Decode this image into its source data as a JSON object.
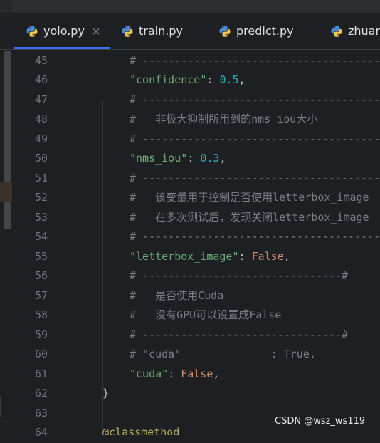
{
  "tabs": [
    {
      "label": "yolo.py",
      "close": "×",
      "active": true
    },
    {
      "label": "train.py",
      "active": false
    },
    {
      "label": "predict.py",
      "active": false
    },
    {
      "label": "zhuan",
      "active": false
    }
  ],
  "lines": [
    {
      "no": "45",
      "segments": [
        {
          "cls": "c-comment",
          "text": "# ---------------------------------------"
        }
      ]
    },
    {
      "no": "46",
      "segments": [
        {
          "cls": "c-str",
          "text": "\"confidence\""
        },
        {
          "cls": "c-punc",
          "text": ": "
        },
        {
          "cls": "c-num",
          "text": "0.5"
        },
        {
          "cls": "c-punc",
          "text": ","
        }
      ]
    },
    {
      "no": "47",
      "segments": [
        {
          "cls": "c-comment",
          "text": "# ---------------------------------------"
        }
      ]
    },
    {
      "no": "48",
      "segments": [
        {
          "cls": "c-comment",
          "text": "#   非极大抑制所用到的nms_iou大小"
        }
      ]
    },
    {
      "no": "49",
      "segments": [
        {
          "cls": "c-comment",
          "text": "# ---------------------------------------"
        }
      ]
    },
    {
      "no": "50",
      "segments": [
        {
          "cls": "c-str",
          "text": "\"nms_iou\""
        },
        {
          "cls": "c-punc",
          "text": ": "
        },
        {
          "cls": "c-num",
          "text": "0.3"
        },
        {
          "cls": "c-punc",
          "text": ","
        }
      ]
    },
    {
      "no": "51",
      "segments": [
        {
          "cls": "c-comment",
          "text": "# ---------------------------------------"
        }
      ]
    },
    {
      "no": "52",
      "segments": [
        {
          "cls": "c-comment",
          "text": "#   该变量用于控制是否使用letterbox_image"
        }
      ]
    },
    {
      "no": "53",
      "segments": [
        {
          "cls": "c-comment",
          "text": "#   在多次测试后，发现关闭letterbox_image"
        }
      ]
    },
    {
      "no": "54",
      "segments": [
        {
          "cls": "c-comment",
          "text": "# ---------------------------------------"
        }
      ]
    },
    {
      "no": "55",
      "segments": [
        {
          "cls": "c-str",
          "text": "\"letterbox_image\""
        },
        {
          "cls": "c-punc",
          "text": ": "
        },
        {
          "cls": "c-kw",
          "text": "False"
        },
        {
          "cls": "c-punc",
          "text": ","
        }
      ]
    },
    {
      "no": "56",
      "segments": [
        {
          "cls": "c-comment",
          "text": "# -------------------------------#"
        }
      ]
    },
    {
      "no": "57",
      "segments": [
        {
          "cls": "c-comment",
          "text": "#   是否使用Cuda"
        }
      ]
    },
    {
      "no": "58",
      "segments": [
        {
          "cls": "c-comment",
          "text": "#   没有GPU可以设置成False"
        }
      ]
    },
    {
      "no": "59",
      "segments": [
        {
          "cls": "c-comment",
          "text": "# -------------------------------#"
        }
      ]
    },
    {
      "no": "60",
      "segments": [
        {
          "cls": "c-comment",
          "text": "# \"cuda\"              : True,"
        }
      ]
    },
    {
      "no": "61",
      "segments": [
        {
          "cls": "c-str",
          "text": "\"cuda\""
        },
        {
          "cls": "c-punc",
          "text": ": "
        },
        {
          "cls": "c-kw",
          "text": "False"
        },
        {
          "cls": "c-punc",
          "text": ","
        }
      ]
    },
    {
      "no": "62",
      "segments": [
        {
          "cls": "c-punc",
          "text": "}"
        }
      ]
    },
    {
      "no": "63",
      "segments": []
    },
    {
      "no": "64",
      "segments": [
        {
          "cls": "c-dec",
          "text": "@classmethod"
        }
      ]
    }
  ],
  "watermark": "CSDN @wsz_ws119"
}
